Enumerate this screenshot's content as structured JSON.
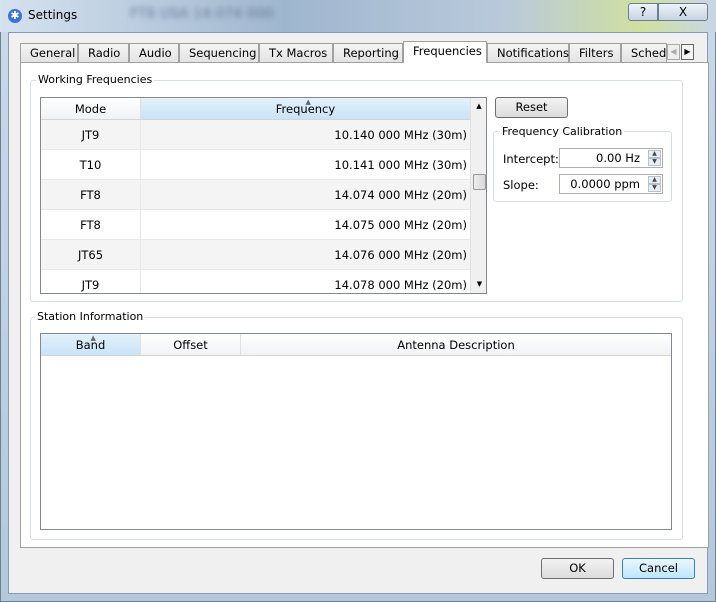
{
  "window": {
    "title": "Settings",
    "help": "?",
    "close": "X",
    "background_text": "FT8  USA  14.074 000"
  },
  "tabs": [
    "General",
    "Radio",
    "Audio",
    "Sequencing",
    "Tx Macros",
    "Reporting",
    "Frequencies",
    "Notifications",
    "Filters",
    "Schedu"
  ],
  "active_tab": "Frequencies",
  "working": {
    "title": "Working Frequencies",
    "columns": [
      "Mode",
      "Frequency"
    ],
    "rows": [
      [
        "JT9",
        "10.140 000 MHz (30m)"
      ],
      [
        "T10",
        "10.141 000 MHz (30m)"
      ],
      [
        "FT8",
        "14.074 000 MHz (20m)"
      ],
      [
        "FT8",
        "14.075 000 MHz (20m)"
      ],
      [
        "JT65",
        "14.076 000 MHz (20m)"
      ],
      [
        "JT9",
        "14.078 000 MHz (20m)"
      ]
    ],
    "reset": "Reset"
  },
  "calibration": {
    "title": "Frequency Calibration",
    "intercept_label": "Intercept:",
    "intercept_value": "0.00 Hz",
    "slope_label": "Slope:",
    "slope_value": "0.0000 ppm"
  },
  "station": {
    "title": "Station Information",
    "columns": [
      "Band",
      "Offset",
      "Antenna Description"
    ]
  },
  "buttons": {
    "ok": "OK",
    "cancel": "Cancel"
  }
}
